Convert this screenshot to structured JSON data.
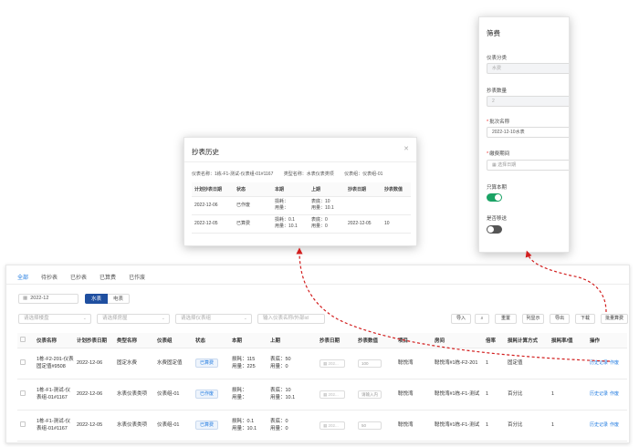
{
  "main": {
    "tabs": [
      {
        "label": "全部",
        "active": true
      },
      {
        "label": "待抄表",
        "active": false
      },
      {
        "label": "已抄表",
        "active": false
      },
      {
        "label": "已算费",
        "active": false
      },
      {
        "label": "已作废",
        "active": false
      }
    ],
    "date_value": "2022-12",
    "segment": {
      "water": "水表",
      "electric": "电表",
      "selected": "水表"
    },
    "filters": {
      "building_placeholder": "请选择楼盘",
      "property_placeholder": "请选择房屋",
      "group_placeholder": "请选择仪表组",
      "search_placeholder": "输入仪表名称/外部id"
    },
    "toolbar": {
      "import": "导入",
      "search_icon": "search-icon",
      "reset": "重置",
      "columns": "列显示",
      "export": "导出",
      "download": "下载",
      "batch_fee": "批量算费"
    },
    "table": {
      "headers": [
        "",
        "仪表名称",
        "计划抄表日期",
        "类型名称",
        "仪表组",
        "状态",
        "本期",
        "上期",
        "抄表日期",
        "抄表数值",
        "项目",
        "房间",
        "倍率",
        "损耗计算方式",
        "损耗率/值",
        "操作"
      ],
      "rows": [
        {
          "name": "1栋-F2-201-仪表固定值#9508",
          "plan_date": "2022-12-06",
          "type": "固定水费",
          "group": "水费固定值",
          "status": "已算费",
          "current_a": "损耗：115",
          "current_b": "用量：225",
          "prev_a": "表底：50",
          "prev_b": "用量：0",
          "read_date": "202...",
          "read_value": "100",
          "project": "聪悦湾",
          "room": "聪悦湾#1栋-F2-201",
          "ratio": "1",
          "loss_method": "固定值",
          "loss_rate": "",
          "actions": [
            "历史记录",
            "作废"
          ]
        },
        {
          "name": "1栋-F1-测试-仪表组-01#1167",
          "plan_date": "2022-12-06",
          "type": "水表仪表类项",
          "group": "仪表组-01",
          "status": "已作废",
          "current_a": "损耗：",
          "current_b": "用量：",
          "prev_a": "表底：10",
          "prev_b": "用量：10.1",
          "read_date": "202...",
          "read_value": "请输入内",
          "project": "聪悦湾",
          "room": "聪悦湾#1栋-F1-测试",
          "ratio": "1",
          "loss_method": "百分比",
          "loss_rate": "1",
          "actions": [
            "历史记录",
            "作废"
          ]
        },
        {
          "name": "1栋-F1-测试-仪表组-01#1167",
          "plan_date": "2022-12-05",
          "type": "水表仪表类项",
          "group": "仪表组-01",
          "status": "已算费",
          "current_a": "损耗：0.1",
          "current_b": "用量：10.1",
          "prev_a": "表底：0",
          "prev_b": "用量：0",
          "read_date": "202...",
          "read_value": "50",
          "project": "聪悦湾",
          "room": "聪悦湾#1栋-F1-测试",
          "ratio": "1",
          "loss_method": "百分比",
          "loss_rate": "1",
          "actions": [
            "历史记录",
            "作废"
          ]
        }
      ]
    }
  },
  "history_modal": {
    "title": "抄表历史",
    "close_icon": "close-icon",
    "meta": {
      "meter_name": "仪表名称：1栋-F1-测试-仪表组-01#1167",
      "type_name": "类型名称：水表仪表类项",
      "group": "仪表组：仪表组-01"
    },
    "headers": [
      "计划抄表日期",
      "状态",
      "本期",
      "上期",
      "抄表日期",
      "抄表数值"
    ],
    "rows": [
      {
        "plan_date": "2022-12-06",
        "status": "已作废",
        "cur_a": "损耗：",
        "cur_b": "用量：",
        "prev_a": "表底：10",
        "prev_b": "用量：10.1",
        "read_date": "",
        "read_value": ""
      },
      {
        "plan_date": "2022-12-05",
        "status": "已算费",
        "cur_a": "损耗：0.1",
        "cur_b": "用量：10.1",
        "prev_a": "表底：0",
        "prev_b": "用量：0",
        "read_date": "2022-12-05",
        "read_value": "10"
      }
    ]
  },
  "filter_panel": {
    "title": "筛费",
    "category_label": "仪表分类",
    "category_value": "水费",
    "count_label": "抄表数量",
    "count_value": "2",
    "batch_label": "批次名称",
    "batch_value": "2022-12-10水表",
    "period_label": "缴费期间",
    "period_placeholder": "选择日期",
    "only_current_label": "只算本期",
    "only_current_on": true,
    "merge_label": "是否移送",
    "merge_on": false
  },
  "colors": {
    "accent": "#1f7ae0",
    "arrow": "#d21e1e",
    "toggle_on": "#1aa365",
    "segment_on": "#1f4fa0"
  }
}
